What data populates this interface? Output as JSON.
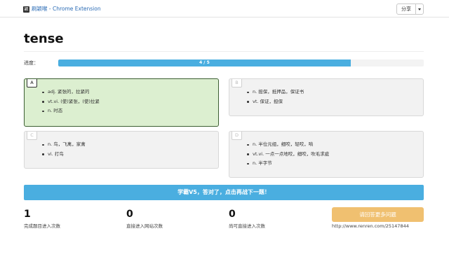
{
  "header": {
    "logo_glyph": "颖",
    "title": "刷颖喉 - Chrome Extension",
    "share_label": "分享"
  },
  "word": "tense",
  "progress": {
    "label": "进度：",
    "text": "4 / 5",
    "current": 4,
    "total": 5,
    "fraction": 0.8
  },
  "options": [
    {
      "letter": "A",
      "selected": true,
      "meanings": [
        "adj. 紧张的，拉紧的",
        "vt.vi. (使)紧张，(使)拉紧",
        "n. 时态"
      ]
    },
    {
      "letter": "B",
      "selected": false,
      "meanings": [
        "n. 担保，抵押品，保证书",
        "vt. 保证，担保"
      ]
    },
    {
      "letter": "C",
      "selected": false,
      "meanings": [
        "n. 鸟，飞禽，家禽",
        "vi. 打鸟"
      ]
    },
    {
      "letter": "D",
      "selected": false,
      "meanings": [
        "n. 半位元组，细咬，轻咬，啃",
        "vt.vi. 一点一点地咬，细咬，吹毛求疵",
        "n. 半字节"
      ]
    }
  ],
  "result_message": "学霸V5，答对了，点击再战下一题！",
  "stats": [
    {
      "value": "1",
      "label": "完成题目进入次数"
    },
    {
      "value": "0",
      "label": "直接进入网站次数"
    },
    {
      "value": "0",
      "label": "尚可直接进入次数"
    }
  ],
  "more": {
    "button_label": "请回答更多问题",
    "url": "http://www.renren.com/25147844"
  },
  "colors": {
    "accent": "#4aaee0",
    "correct_bg": "#dcefd0",
    "more_button": "#f0c070"
  }
}
